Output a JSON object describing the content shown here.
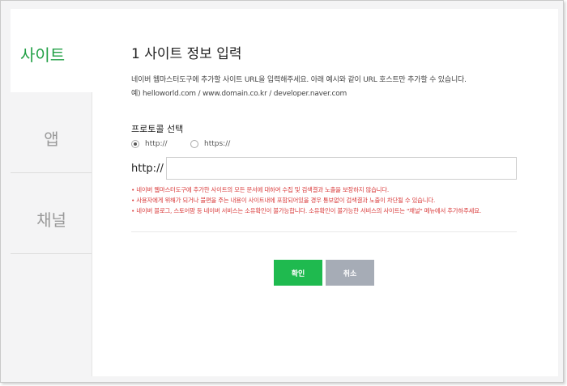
{
  "tabs": [
    {
      "label": "사이트",
      "active": true
    },
    {
      "label": "앱",
      "active": false
    },
    {
      "label": "채널",
      "active": false
    }
  ],
  "main": {
    "title": "1 사이트 정보 입력",
    "description": "네이버 웹마스터도구에 추가할 사이트 URL을 입력해주세요. 아래 예시와 같이 URL 호스트만 추가할 수 있습니다.",
    "example": "예) helloworld.com / www.domain.co.kr / developer.naver.com",
    "protocol_title": "프로토콜 선택",
    "protocols": [
      {
        "label": "http://",
        "checked": true
      },
      {
        "label": "https://",
        "checked": false
      }
    ],
    "url_prefix": "http://",
    "url_value": "",
    "url_placeholder": "",
    "notes": [
      "• 네이버 웹마스터도구에 추가한 사이트의 모든 문서에 대하여 수집 및 검색결과 노출을 보장하지 않습니다.",
      "• 사용자에게 위해가 되거나 불편을 주는 내용이 사이트내에 포함되어있을 경우 통보없이 검색결과 노출이 차단될 수 있습니다.",
      "• 네이버 블로그, 스토어팜 등 네이버 서비스는 소유확인이 불가능합니다. 소유확인이 불가능한 서비스의 사이트는 \"채널\" 메뉴에서 추가하주세요."
    ],
    "confirm_label": "확인",
    "cancel_label": "취소"
  },
  "colors": {
    "accent": "#22a046",
    "confirm_button": "#1fba4f",
    "cancel_button": "#a6acb6",
    "note_text": "#d93a3a"
  }
}
